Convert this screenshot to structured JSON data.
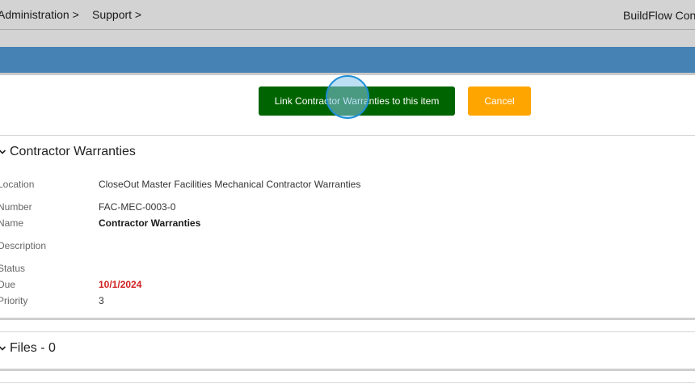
{
  "nav": {
    "administration": "Administration >",
    "support": "Support >",
    "brand": "BuildFlow Con"
  },
  "actions": {
    "link_label": "Link Contractor Warranties to this item",
    "cancel_label": "Cancel"
  },
  "colors": {
    "nav_bg": "#d3d3d3",
    "header_blue": "#4682b4",
    "link_button": "#006400",
    "cancel_button": "#ffa500",
    "due_date": "#d02020"
  },
  "warranties": {
    "title": "Contractor Warranties",
    "fields": {
      "location": {
        "label": "Location",
        "value": "CloseOut Master Facilities Mechanical Contractor Warranties"
      },
      "number": {
        "label": "Number",
        "value": "FAC-MEC-0003-0"
      },
      "name": {
        "label": "Name",
        "value": "Contractor Warranties"
      },
      "description": {
        "label": "Description",
        "value": ""
      },
      "status": {
        "label": "Status",
        "value": ""
      },
      "due": {
        "label": "Due",
        "value": "10/1/2024"
      },
      "priority": {
        "label": "Priority",
        "value": "3"
      }
    }
  },
  "files": {
    "title": "Files - 0"
  },
  "icons": {
    "section_toggle": "chevron-down-icon"
  }
}
